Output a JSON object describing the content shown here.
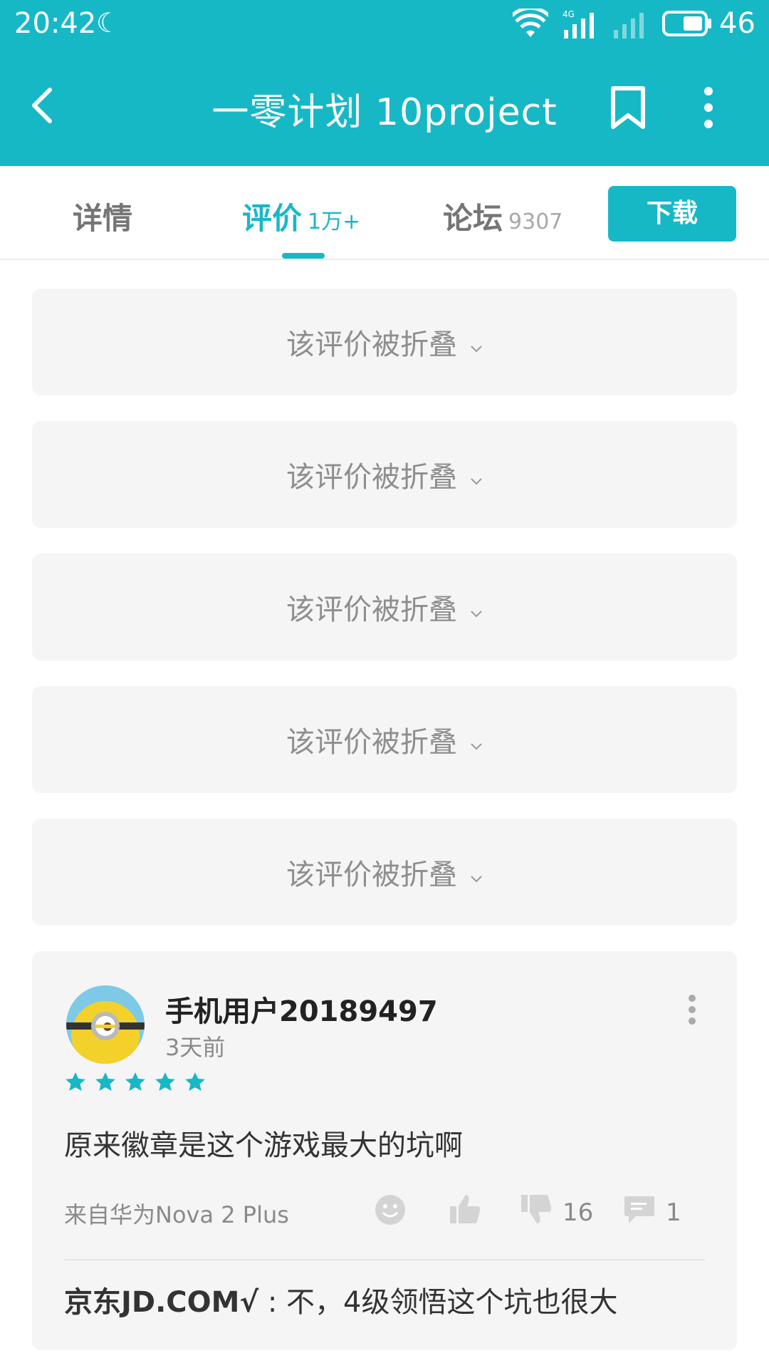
{
  "status_bar": {
    "time": "20:42",
    "battery_level": "46",
    "network": "4G",
    "icons": [
      "moon-icon",
      "wifi-icon",
      "signal-4g-icon",
      "signal-icon",
      "battery-icon"
    ]
  },
  "app_bar": {
    "title": "一零计划 10project",
    "icons": [
      "back-arrow-icon",
      "bookmark-icon",
      "more-vertical-icon"
    ]
  },
  "tabs": [
    {
      "label": "详情",
      "count": ""
    },
    {
      "label": "评价",
      "count": "1万+"
    },
    {
      "label": "论坛",
      "count": "9307"
    }
  ],
  "active_tab": "评价",
  "download_label": "下载",
  "collapsed_reviews": [
    {
      "text": "该评价被折叠"
    },
    {
      "text": "该评价被折叠"
    },
    {
      "text": "该评价被折叠"
    },
    {
      "text": "该评价被折叠"
    },
    {
      "text": "该评价被折叠"
    }
  ],
  "review": {
    "username": "手机用户20189497",
    "time_ago": "3天前",
    "rating": 5,
    "text": "原来徽章是这个游戏最大的坑啊",
    "device": "来自华为Nova 2 Plus",
    "dislike_count": "16",
    "comment_count": "1",
    "reply": {
      "author": "京东JD.COM√",
      "separator": " : ",
      "text": "不，4级领悟这个坑也很大"
    }
  },
  "colors": {
    "accent": "#17b8c6",
    "card_bg": "#f5f5f5",
    "muted_text": "#8e8e8e"
  }
}
